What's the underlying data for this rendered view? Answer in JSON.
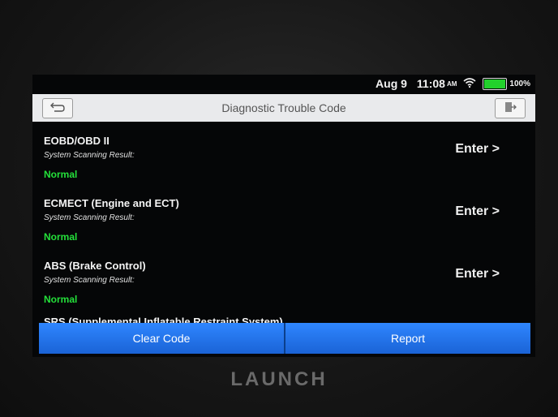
{
  "status": {
    "date": "Aug 9",
    "time": "11:08",
    "ampm": "AM",
    "wifi_icon": "wifi-icon",
    "battery_level": 100,
    "battery_text": "100%"
  },
  "titlebar": {
    "title": "Diagnostic Trouble Code",
    "back_icon": "back-arrow-icon",
    "exit_icon": "exit-icon"
  },
  "systems": [
    {
      "name": "EOBD/OBD II",
      "label": "System Scanning Result:",
      "result": "Normal",
      "action": "Enter >"
    },
    {
      "name": "ECMECT (Engine and ECT)",
      "label": "System Scanning Result:",
      "result": "Normal",
      "action": "Enter >"
    },
    {
      "name": "ABS (Brake Control)",
      "label": "System Scanning Result:",
      "result": "Normal",
      "action": "Enter >"
    },
    {
      "name": "SRS (Supplemental Inflatable Restraint System)"
    }
  ],
  "actions": {
    "clear_label": "Clear Code",
    "report_label": "Report"
  },
  "brand": "LAUNCH",
  "colors": {
    "normal": "#24e03a",
    "accent": "#2f86ff",
    "titlebar": "#e9eaec"
  }
}
